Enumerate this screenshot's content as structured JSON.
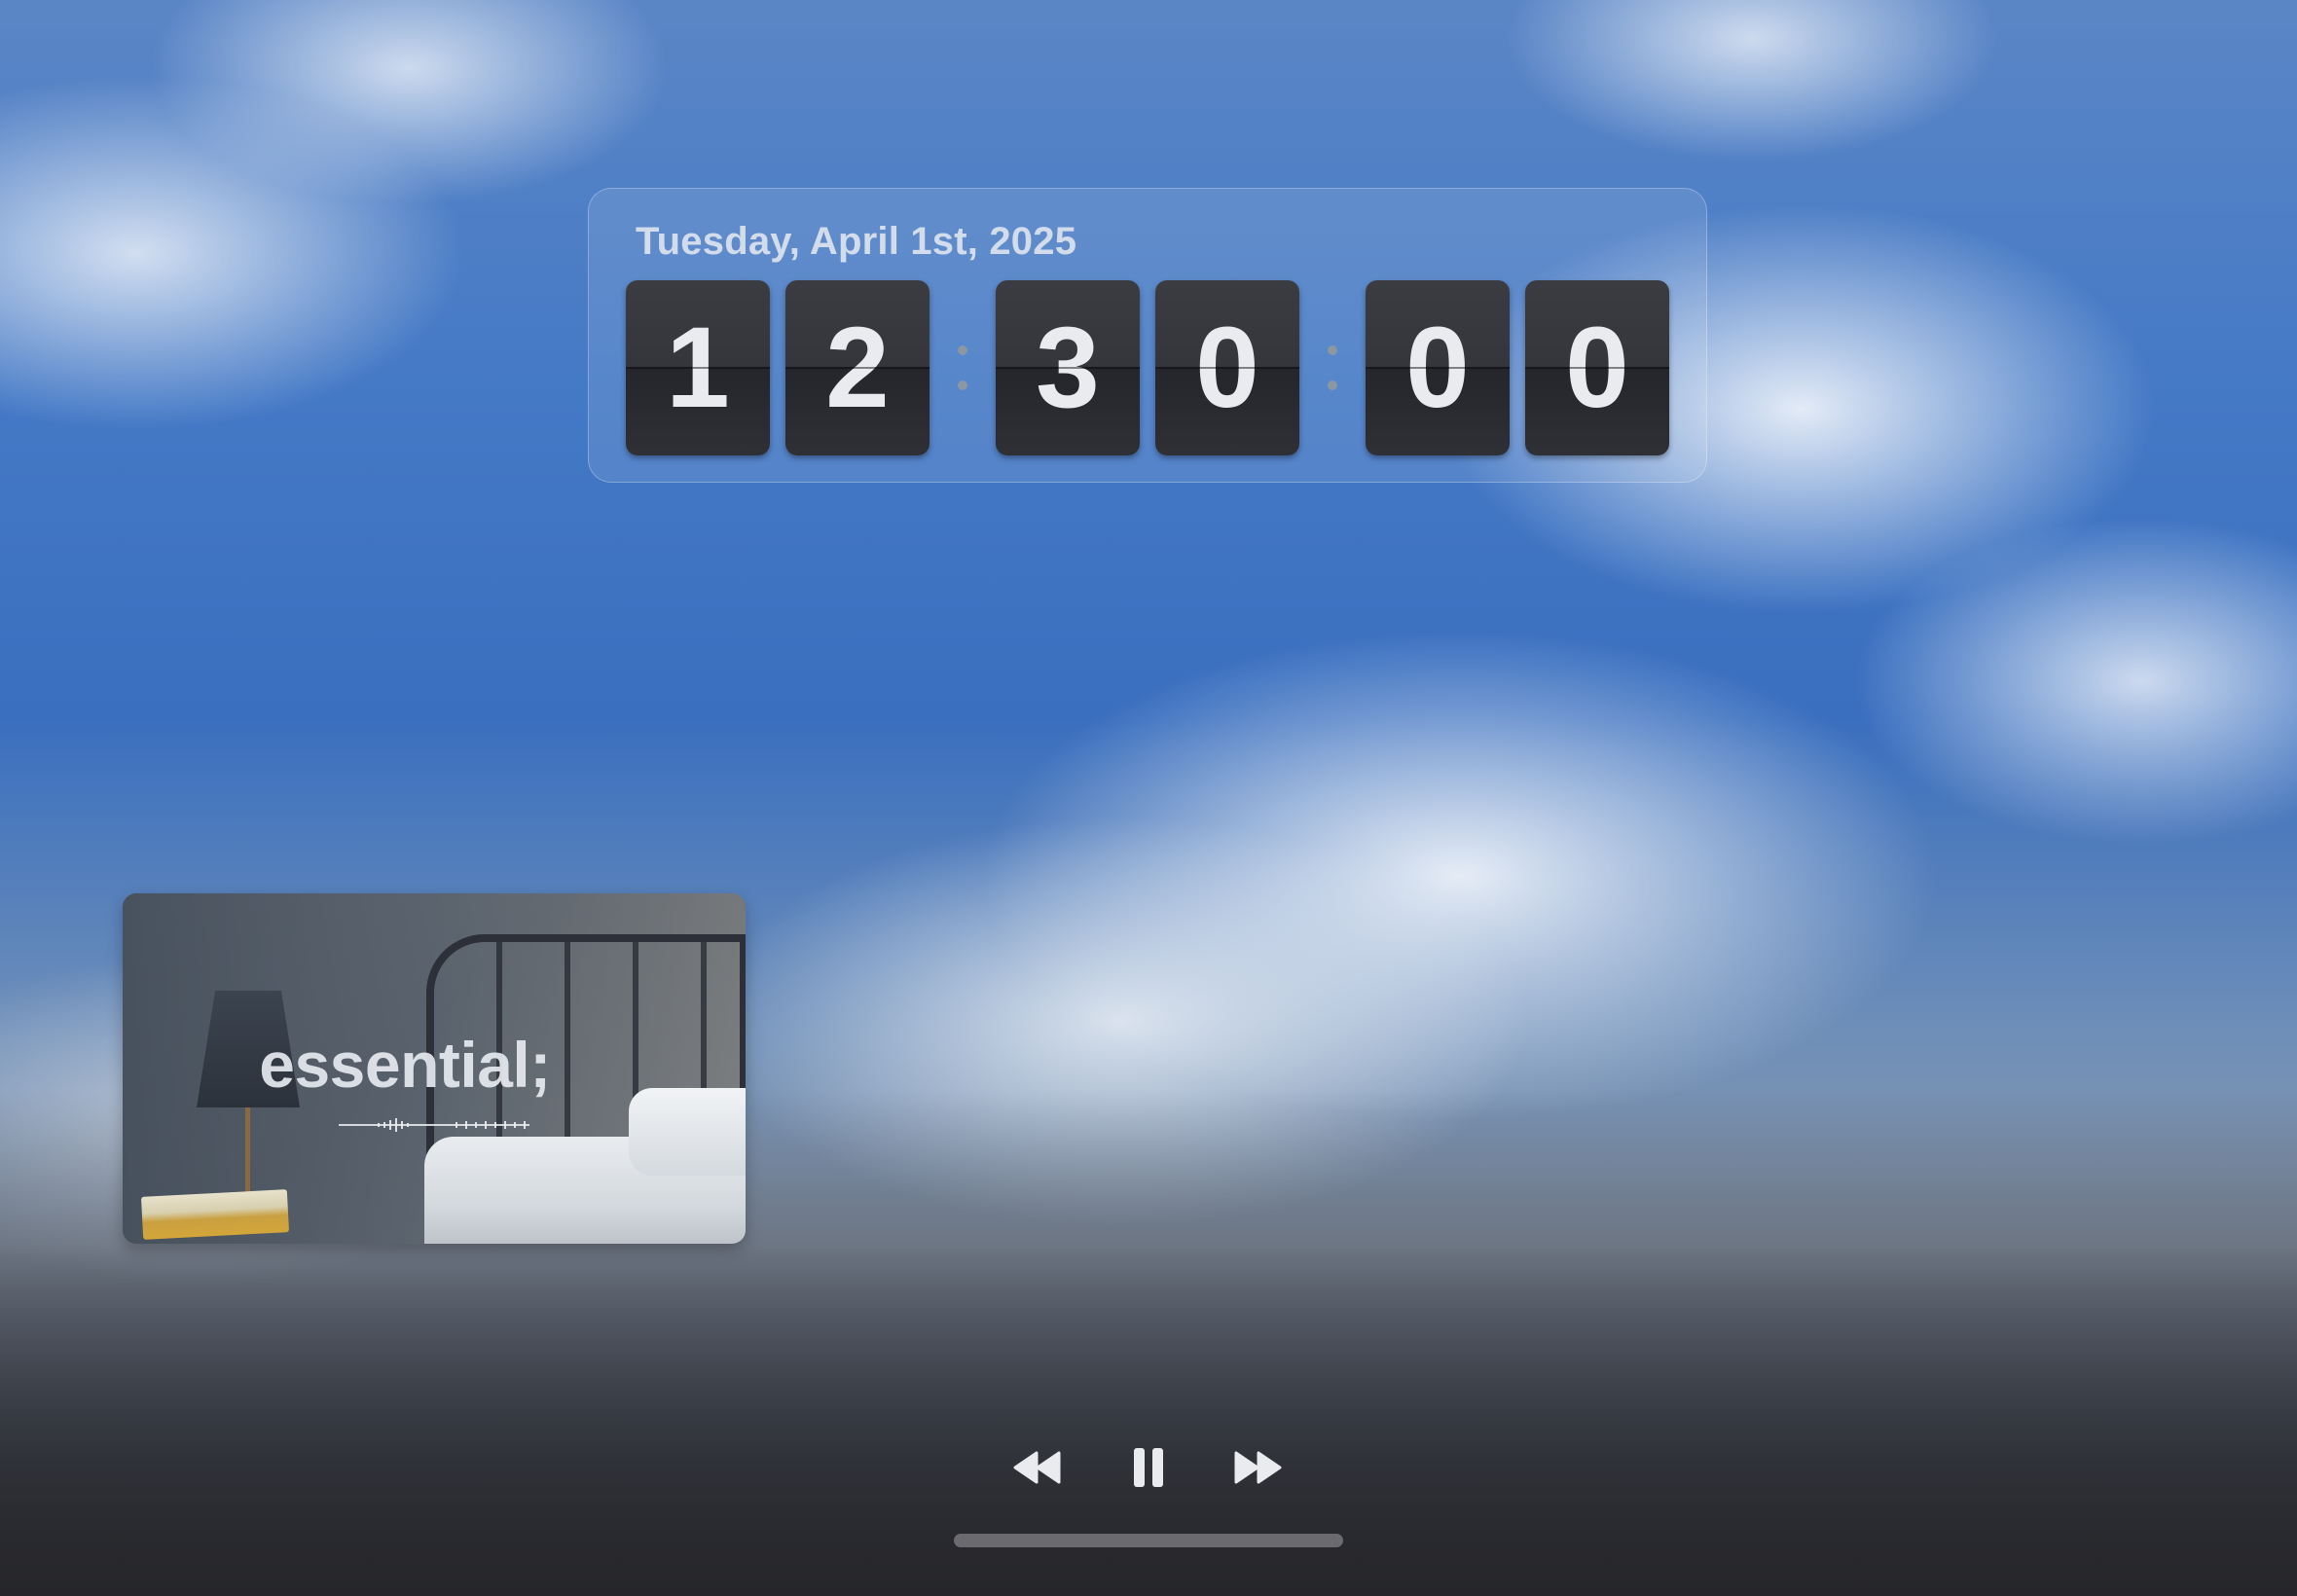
{
  "clock": {
    "date": "Tuesday, April 1st, 2025",
    "digits": [
      "1",
      "2",
      "3",
      "0",
      "0",
      "0"
    ]
  },
  "now_playing": {
    "title": "essential;"
  },
  "controls": {
    "previous_icon": "rewind-icon",
    "play_pause_icon": "pause-icon",
    "next_icon": "fast-forward-icon"
  },
  "colors": {
    "digit_bg": "#2e3035",
    "digit_text": "#e9ebee",
    "sky": "#3a6fbf"
  }
}
